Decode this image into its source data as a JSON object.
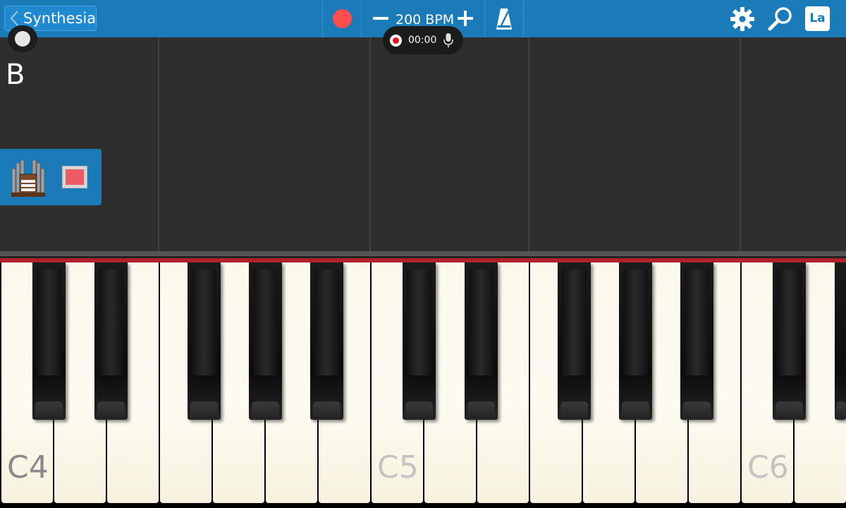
{
  "topbar": {
    "back_label": "Synthesia",
    "bpm_label": "200 BPM",
    "language_label": "La",
    "icons": {
      "back": "chevron-left-icon",
      "record": "record-icon",
      "minus": "minus-icon",
      "plus": "plus-icon",
      "metronome": "metronome-icon",
      "settings": "gear-icon",
      "search": "magnifier-icon"
    }
  },
  "recorder": {
    "time": "00:00"
  },
  "timeline": {
    "note_letter": "B"
  },
  "instrument": {
    "icon": "pipe-organ-icon",
    "color": "#ee5b64"
  },
  "keyboard": {
    "label_C4": "C4",
    "label_C5": "C5",
    "label_C6": "C6"
  },
  "colors": {
    "accent": "#1a7bb8",
    "record": "#ff4c4c",
    "keyboard_strip": "#b0222a",
    "timeline_bg": "#2e2e2e"
  }
}
